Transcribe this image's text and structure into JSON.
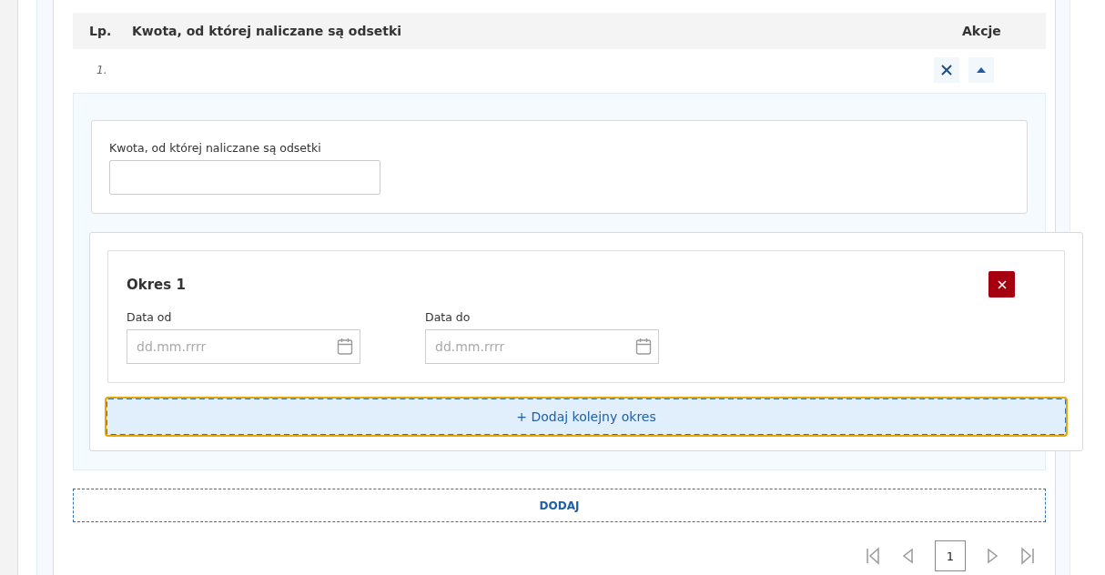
{
  "table": {
    "columns": [
      "Lp.",
      "Kwota, od której naliczane są odsetki",
      "Akcje"
    ],
    "rows": [
      {
        "index": "1.",
        "expanded": true
      }
    ]
  },
  "amount_field": {
    "label": "Kwota, od której naliczane są odsetki"
  },
  "periods": [
    {
      "title": "Okres 1",
      "fields": [
        {
          "label": "Data od",
          "placeholder": "dd.mm.rrrr"
        },
        {
          "label": "Data do",
          "placeholder": "dd.mm.rrrr"
        }
      ]
    }
  ],
  "add_period_button": {
    "label": "+ Dodaj kolejny okres",
    "focused": true
  },
  "add_button": {
    "label": "DODAJ"
  },
  "pagination": {
    "page": "1"
  }
}
